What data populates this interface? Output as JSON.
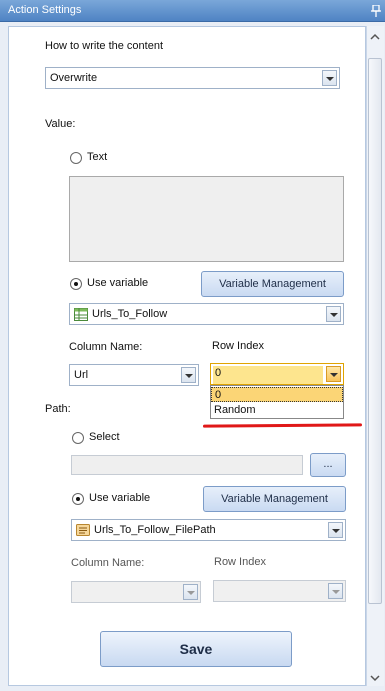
{
  "window": {
    "title": "Action Settings"
  },
  "write_mode": {
    "label": "How to write the content",
    "value": "Overwrite"
  },
  "value_section": {
    "label": "Value:",
    "text_option": "Text",
    "text_value": "",
    "use_variable_label": "Use variable",
    "variable_management_label": "Variable Management",
    "variable_value": "Urls_To_Follow",
    "variable_icon": "table-icon",
    "column_name_label": "Column Name:",
    "column_name_value": "Url",
    "row_index_label": "Row Index",
    "row_index_value": "0",
    "row_index_options": [
      "0",
      "Random"
    ]
  },
  "path_section": {
    "label": "Path:",
    "select_option": "Select",
    "select_value": "",
    "browse_label": "...",
    "use_variable_label": "Use variable",
    "variable_management_label": "Variable Management",
    "variable_value": "Urls_To_Follow_FilePath",
    "variable_icon": "abc-text-icon",
    "column_name_label": "Column Name:",
    "column_name_value": "",
    "row_index_label": "Row Index",
    "row_index_value": ""
  },
  "save_label": "Save",
  "colors": {
    "accent": "#4f83c4",
    "highlight": "#fde58e",
    "annotation": "#e01818"
  }
}
